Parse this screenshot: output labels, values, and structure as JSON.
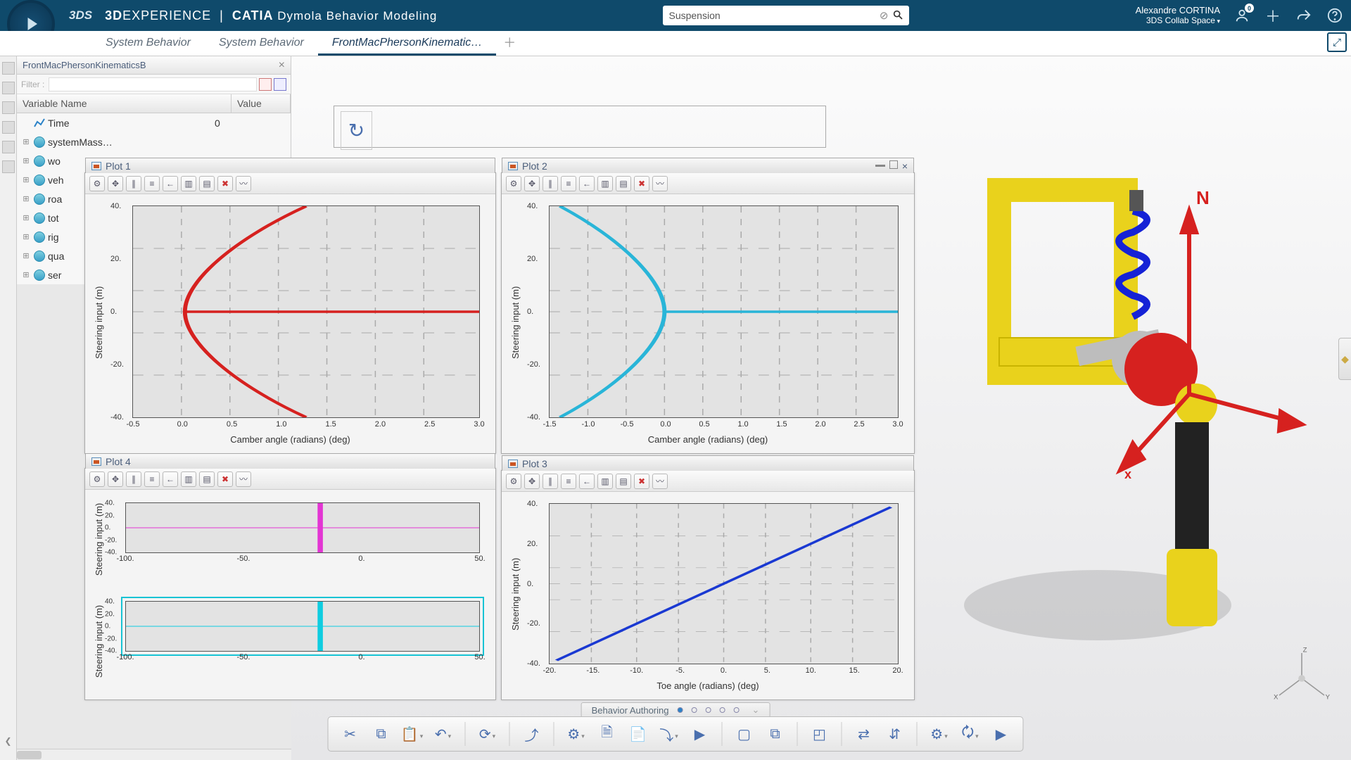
{
  "header": {
    "ds": "3DS",
    "brand_bold": "3D",
    "brand_thin": "EXPERIENCE",
    "pipe": "|",
    "brand_app_bold": "CATIA",
    "brand_app_thin": " Dymola Behavior Modeling",
    "search_value": "Suspension",
    "user_name": "Alexandre CORTINA",
    "user_role": "3DS Collab Space",
    "notif_badge": "0"
  },
  "tabs": [
    {
      "label": "System Behavior",
      "active": false
    },
    {
      "label": "System Behavior",
      "active": false
    },
    {
      "label": "FrontMacPhersonKinematic…",
      "active": true
    }
  ],
  "sidepanel": {
    "title": "FrontMacPhersonKinematicsB",
    "filter_label": "Filter :",
    "col_name": "Variable Name",
    "col_value": "Value",
    "rows": [
      {
        "name": "Time",
        "value": "0",
        "tw": "",
        "icon": "line"
      },
      {
        "name": "systemMass…",
        "value": "",
        "tw": "⊞",
        "icon": "ball"
      },
      {
        "name": "wo",
        "value": "",
        "tw": "⊞",
        "icon": "ball"
      },
      {
        "name": "veh",
        "value": "",
        "tw": "⊞",
        "icon": "ball"
      },
      {
        "name": "roa",
        "value": "",
        "tw": "⊞",
        "icon": "ball"
      },
      {
        "name": "tot",
        "value": "",
        "tw": "⊞",
        "icon": "ball"
      },
      {
        "name": "rig",
        "value": "",
        "tw": "⊞",
        "icon": "ball"
      },
      {
        "name": "qua",
        "value": "",
        "tw": "⊞",
        "icon": "ball"
      },
      {
        "name": "ser",
        "value": "",
        "tw": "⊞",
        "icon": "ball"
      }
    ]
  },
  "plots": {
    "p1": {
      "title": "Plot 1",
      "ylabel": "Steering input (m)",
      "xlabel": "Camber angle (radians) (deg)"
    },
    "p2": {
      "title": "Plot 2",
      "ylabel": "Steering input (m)",
      "xlabel": "Camber angle (radians) (deg)"
    },
    "p3": {
      "title": "Plot 3",
      "ylabel": "Steering input (m)",
      "xlabel": "Toe angle (radians) (deg)"
    },
    "p4": {
      "title": "Plot 4",
      "ylabel1": "Steering input (m)",
      "ylabel2": "Steering input (m)"
    }
  },
  "xticks_camber": [
    "-0.5",
    "0.0",
    "0.5",
    "1.0",
    "1.5",
    "2.0",
    "2.5",
    "3.0"
  ],
  "xticks_camber2": [
    "-1.5",
    "-1.0",
    "-0.5",
    "0.0",
    "0.5",
    "1.0",
    "1.5",
    "2.0",
    "2.5",
    "3.0"
  ],
  "xticks_toe": [
    "-20.",
    "-15.",
    "-10.",
    "-5.",
    "0.",
    "5.",
    "10.",
    "15.",
    "20."
  ],
  "xticks_wide": [
    "-100.",
    "-50.",
    "0.",
    "50."
  ],
  "yticks_std": [
    "40.",
    "20.",
    "0.",
    "-20.",
    "-40."
  ],
  "yticks_compact": [
    "40.",
    "20.",
    "0.",
    "-20.",
    "-40."
  ],
  "behavior_label": "Behavior Authoring",
  "compass_n": "N",
  "axis_z": "Z",
  "axis_y": "Y",
  "axis_x": "X",
  "chart_data": [
    {
      "id": "Plot 1",
      "type": "line",
      "title": "",
      "xlabel": "Camber angle (radians) (deg)",
      "ylabel": "Steering input (m)",
      "xlim": [
        -0.5,
        3.0
      ],
      "ylim": [
        -50,
        50
      ],
      "series": [
        {
          "name": "curve",
          "color": "#d6211f",
          "x": [
            1.3,
            0.8,
            0.4,
            0.1,
            0.0,
            0.1,
            0.4,
            0.8,
            1.3
          ],
          "y": [
            50,
            40,
            25,
            12,
            0,
            -12,
            -25,
            -40,
            -50
          ]
        },
        {
          "name": "axis-ref",
          "color": "#d6211f",
          "x": [
            -0.5,
            3.0
          ],
          "y": [
            0,
            0
          ]
        }
      ]
    },
    {
      "id": "Plot 2",
      "type": "line",
      "title": "",
      "xlabel": "Camber angle (radians) (deg)",
      "ylabel": "Steering input (m)",
      "xlim": [
        -1.5,
        3.0
      ],
      "ylim": [
        -50,
        50
      ],
      "series": [
        {
          "name": "curve",
          "color": "#29b5d8",
          "x": [
            -1.5,
            -1.0,
            -0.6,
            -0.2,
            0.0,
            -0.2,
            -0.6,
            -1.0,
            -1.5
          ],
          "y": [
            -50,
            -40,
            -25,
            -12,
            0,
            12,
            25,
            40,
            50
          ]
        },
        {
          "name": "axis-ref",
          "color": "#29b5d8",
          "x": [
            0.0,
            3.0
          ],
          "y": [
            0,
            0
          ]
        }
      ]
    },
    {
      "id": "Plot 3",
      "type": "line",
      "title": "",
      "xlabel": "Toe angle (radians) (deg)",
      "ylabel": "Steering input (m)",
      "xlim": [
        -20,
        20
      ],
      "ylim": [
        -50,
        50
      ],
      "series": [
        {
          "name": "curve",
          "color": "#1a39d2",
          "x": [
            -20,
            20
          ],
          "y": [
            -50,
            50
          ]
        }
      ]
    },
    {
      "id": "Plot 4a",
      "type": "line",
      "title": "",
      "xlabel": "",
      "ylabel": "Steering input (m)",
      "xlim": [
        -100,
        80
      ],
      "ylim": [
        -40,
        40
      ],
      "series": [
        {
          "name": "h",
          "color": "#e335d3",
          "x": [
            -100,
            80
          ],
          "y": [
            0,
            0
          ]
        },
        {
          "name": "v",
          "color": "#e335d3",
          "x": [
            0,
            0
          ],
          "y": [
            -40,
            40
          ]
        }
      ]
    },
    {
      "id": "Plot 4b",
      "type": "line",
      "title": "",
      "xlabel": "",
      "ylabel": "Steering input (m)",
      "xlim": [
        -100,
        80
      ],
      "ylim": [
        -40,
        40
      ],
      "series": [
        {
          "name": "h",
          "color": "#0fcde0",
          "x": [
            -100,
            80
          ],
          "y": [
            0,
            0
          ]
        },
        {
          "name": "v",
          "color": "#0fcde0",
          "x": [
            0,
            0
          ],
          "y": [
            -40,
            40
          ]
        }
      ]
    }
  ]
}
